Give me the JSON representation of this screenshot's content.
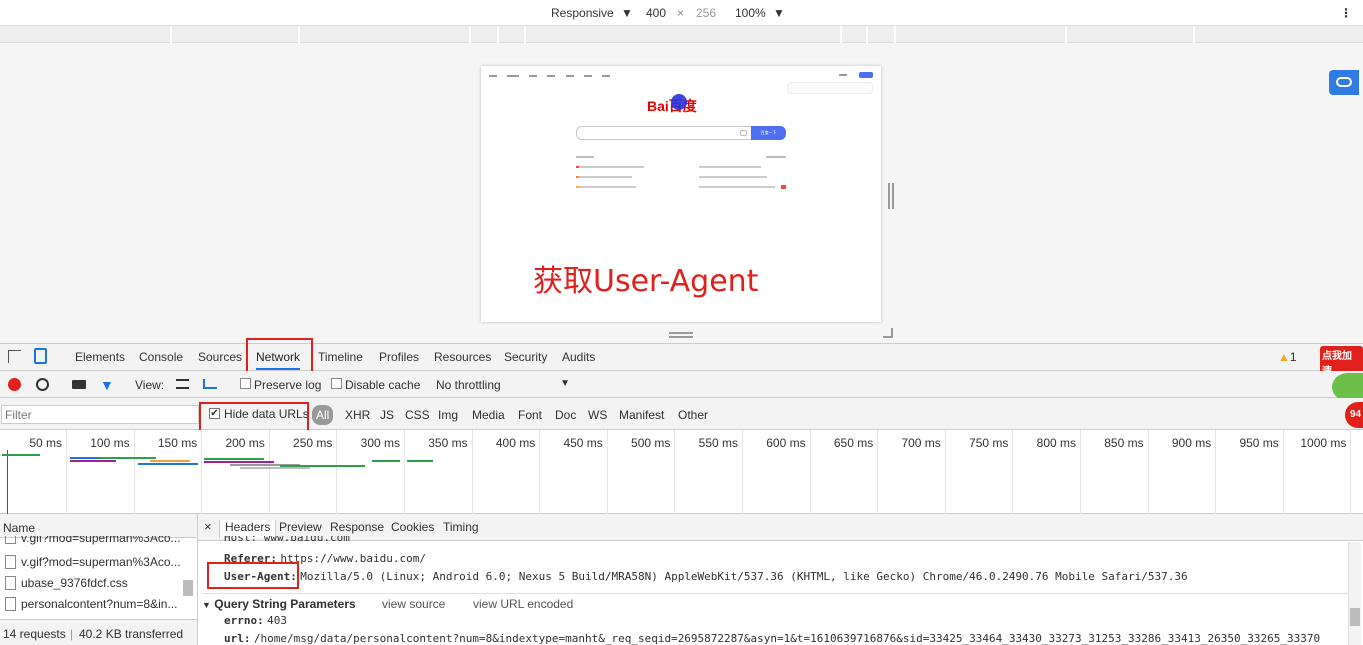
{
  "device_toolbar": {
    "mode": "Responsive",
    "width": "400",
    "times": "×",
    "height": "256",
    "zoom": "100%",
    "more": "⋮"
  },
  "baidu_page": {
    "logo": "Bai百度",
    "search_button": "百度一下",
    "overlay_caption": "获取User-Agent"
  },
  "devtools": {
    "tabs": [
      "Elements",
      "Console",
      "Sources",
      "Network",
      "Timeline",
      "Profiles",
      "Resources",
      "Security",
      "Audits"
    ],
    "warning_count": "1",
    "extension_label": "点我加速",
    "extension_badge": "94",
    "toolbar": {
      "view_label": "View:",
      "preserve_log": "Preserve log",
      "disable_cache": "Disable cache",
      "throttling": "No throttling"
    },
    "filter": {
      "placeholder": "Filter",
      "hide_data_urls": "Hide data URLs",
      "types": [
        "All",
        "XHR",
        "JS",
        "CSS",
        "Img",
        "Media",
        "Font",
        "Doc",
        "WS",
        "Manifest",
        "Other"
      ]
    },
    "timeline_ticks": [
      "50 ms",
      "100 ms",
      "150 ms",
      "200 ms",
      "250 ms",
      "300 ms",
      "350 ms",
      "400 ms",
      "450 ms",
      "500 ms",
      "550 ms",
      "600 ms",
      "650 ms",
      "700 ms",
      "750 ms",
      "800 ms",
      "850 ms",
      "900 ms",
      "950 ms",
      "1000 ms"
    ],
    "requests": {
      "header": "Name",
      "items": [
        "v.gif?mod=superman%3Aco...",
        "v.gif?mod=superman%3Aco...",
        "ubase_9376fdcf.css",
        "personalcontent?num=8&in..."
      ],
      "status": "14 requests",
      "separator": "|",
      "transferred": "40.2 KB transferred"
    },
    "detail": {
      "close": "×",
      "tabs": [
        "Headers",
        "Preview",
        "Response",
        "Cookies",
        "Timing"
      ],
      "host_row": "Host: www.baidu.com",
      "referer_key": "Referer:",
      "referer_value": "https://www.baidu.com/",
      "ua_key": "User-Agent:",
      "ua_value": "Mozilla/5.0 (Linux; Android 6.0; Nexus 5 Build/MRA58N) AppleWebKit/537.36 (KHTML, like Gecko) Chrome/46.0.2490.76 Mobile Safari/537.36",
      "qs_title": "Query String Parameters",
      "view_source": "view source",
      "view_url_encoded": "view URL encoded",
      "errno_key": "errno:",
      "errno_value": "403",
      "url_key": "url:",
      "url_value": "/home/msg/data/personalcontent?num=8&indextype=manht&_req_seqid=2695872287&asyn=1&t=1610639716876&sid=33425_33464_33430_33273_31253_33286_33413_26350_33265_33370"
    }
  },
  "colors": {
    "annotation_red": "#e0201a",
    "devtools_blue": "#1a73e8",
    "baidu_blue": "#4e6ef2"
  }
}
